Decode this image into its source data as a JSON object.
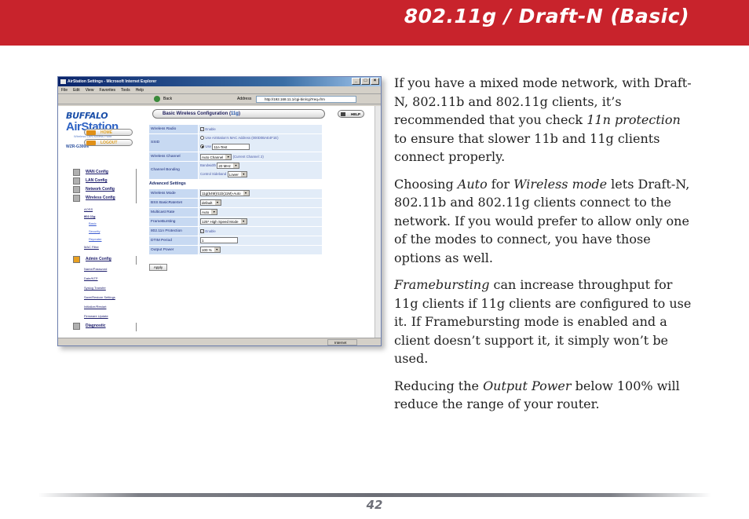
{
  "header": {
    "title": "802.11g / Draft-N (Basic)"
  },
  "screenshot": {
    "window_title": "AirStation Settings - Microsoft Internet Explorer",
    "menu": [
      "File",
      "Edit",
      "View",
      "Favorites",
      "Tools",
      "Help"
    ],
    "toolbar_back": "Back",
    "address_label": "Address",
    "address_url": "http://192.168.11.1/cgi-bin/cgi?req=frm",
    "brand": "BUFFALO",
    "product": "AirStation",
    "subtitle": "Wireless LAN Access Point",
    "model": "WZR-G300N",
    "home": "HOME",
    "logout": "LOGOUT",
    "nav": {
      "wan": "WAN Config",
      "lan": "LAN Config",
      "network": "Network Config",
      "wireless": "Wireless Config",
      "aoss": "AOSS",
      "w11g": "802.11g",
      "basic": "Basic",
      "security": "Security",
      "repeater": "Repeater",
      "mac": "MAC Filter",
      "admin": "Admin Config",
      "name_password": "Name/Password",
      "date_ntp": "Date/NTP",
      "syslog": "Syslog Transfer",
      "save_restore": "Save/Restore Settings",
      "initialize": "Initialize/Restart",
      "firmware": "Firmware Update",
      "diagnostic": "Diagnostic"
    },
    "config_title_prefix": "Basic Wireless Configuration (",
    "config_title_mode": "11g",
    "config_title_suffix": ")",
    "help": "HELP",
    "fields": {
      "radio_label": "Wireless Radio",
      "radio_value": "Enable",
      "ssid_label": "SSID",
      "ssid_opt1": "Use AirStation's MAC Address (000D0BAE4F1E)",
      "ssid_opt2": "Use",
      "ssid_value": "11n-Test",
      "channel_label": "Wireless Channel",
      "channel_value": "Auto Channel",
      "channel_current": "(Current Channel: 2)",
      "bonding_label": "Channel Bonding",
      "bandwidth_label": "Bandwidth",
      "bandwidth_value": "20 MHz",
      "sideband_label": "Control Sideband",
      "sideband_value": "Lower"
    },
    "advanced_label": "Advanced Settings",
    "advanced": [
      {
        "label": "Wireless Mode",
        "value": "11g(54M)/11b(11M)-Auto"
      },
      {
        "label": "BSS BasicRateSet",
        "value": "default"
      },
      {
        "label": "Multicast Rate",
        "value": "Auto"
      },
      {
        "label": "FrameBursting",
        "value": "125* High Speed Mode"
      },
      {
        "label": "802.11n Protection",
        "value": "Enable"
      },
      {
        "label": "DTIM Period",
        "value": "1"
      },
      {
        "label": "Output Power",
        "value": "100 %"
      }
    ],
    "apply": "Apply",
    "status_zone": "Internet"
  },
  "text": {
    "p1_a": "If you have a mixed mode network, with Draft-N, 802.11b and 802.11g clients, it’s recommended that you check ",
    "p1_em": "11n protection",
    "p1_b": " to ensure that slower 11b and 11g clients connect properly.",
    "p2_a": "Choosing ",
    "p2_em1": "Auto",
    "p2_b": " for ",
    "p2_em2": "Wireless mode",
    "p2_c": " lets Draft-N, 802.11b and 802.11g clients connect to the network.  If you would prefer to allow only one of the modes to connect, you have those options as well.",
    "p3_em": "Framebursting",
    "p3_b": " can increase throughput for 11g clients if 11g clients are configured to use it.  If Framebursting mode is enabled and a client doesn’t support it, it simply won’t be used.",
    "p4_a": "Reducing the ",
    "p4_em": "Output Power",
    "p4_b": " below 100% will reduce the range of your router."
  },
  "footer": {
    "page_number": "42"
  }
}
